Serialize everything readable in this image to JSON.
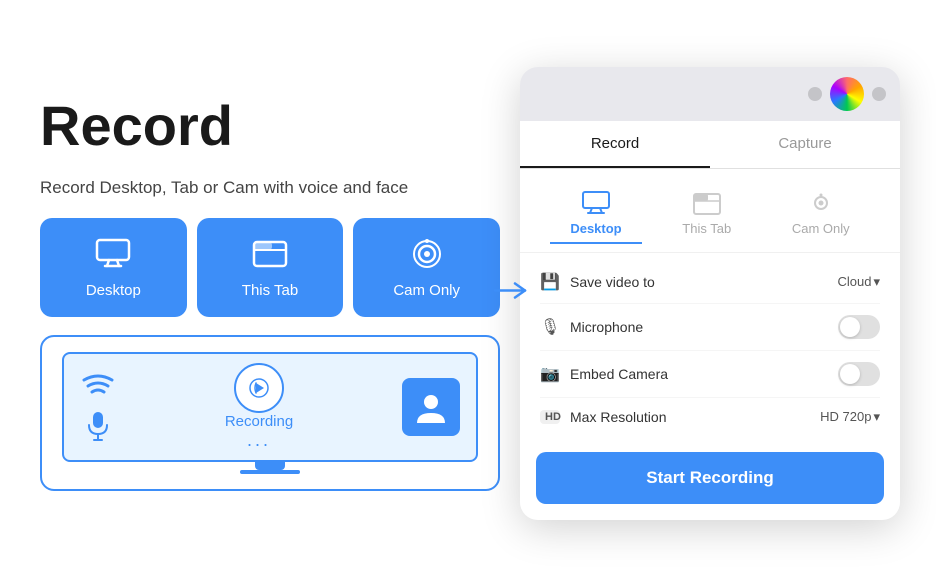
{
  "left": {
    "title": "Record",
    "subtitle": "Record Desktop, Tab or Cam with voice and face",
    "buttons": [
      {
        "id": "desktop",
        "label": "Desktop",
        "icon": "desktop"
      },
      {
        "id": "this-tab",
        "label": "This Tab",
        "icon": "tab"
      },
      {
        "id": "cam-only",
        "label": "Cam Only",
        "icon": "cam"
      }
    ],
    "preview": {
      "recording_label": "Recording",
      "recording_dots": "..."
    }
  },
  "right": {
    "tabs": [
      {
        "id": "record",
        "label": "Record",
        "active": true
      },
      {
        "id": "capture",
        "label": "Capture",
        "active": false
      }
    ],
    "modes": [
      {
        "id": "desktop",
        "label": "Desktop",
        "active": true
      },
      {
        "id": "this-tab",
        "label": "This Tab",
        "active": false
      },
      {
        "id": "cam-only",
        "label": "Cam Only",
        "active": false
      }
    ],
    "settings": [
      {
        "id": "save-video",
        "icon": "💾",
        "label": "Save video to",
        "value": "Cloud",
        "type": "dropdown"
      },
      {
        "id": "microphone",
        "icon": "🎙",
        "label": "Microphone",
        "value": "",
        "type": "toggle"
      },
      {
        "id": "embed-camera",
        "icon": "📷",
        "label": "Embed Camera",
        "value": "",
        "type": "toggle"
      },
      {
        "id": "max-resolution",
        "icon": "HD",
        "label": "Max Resolution",
        "value": "HD 720p",
        "type": "dropdown"
      }
    ],
    "start_button": "Start Recording"
  }
}
